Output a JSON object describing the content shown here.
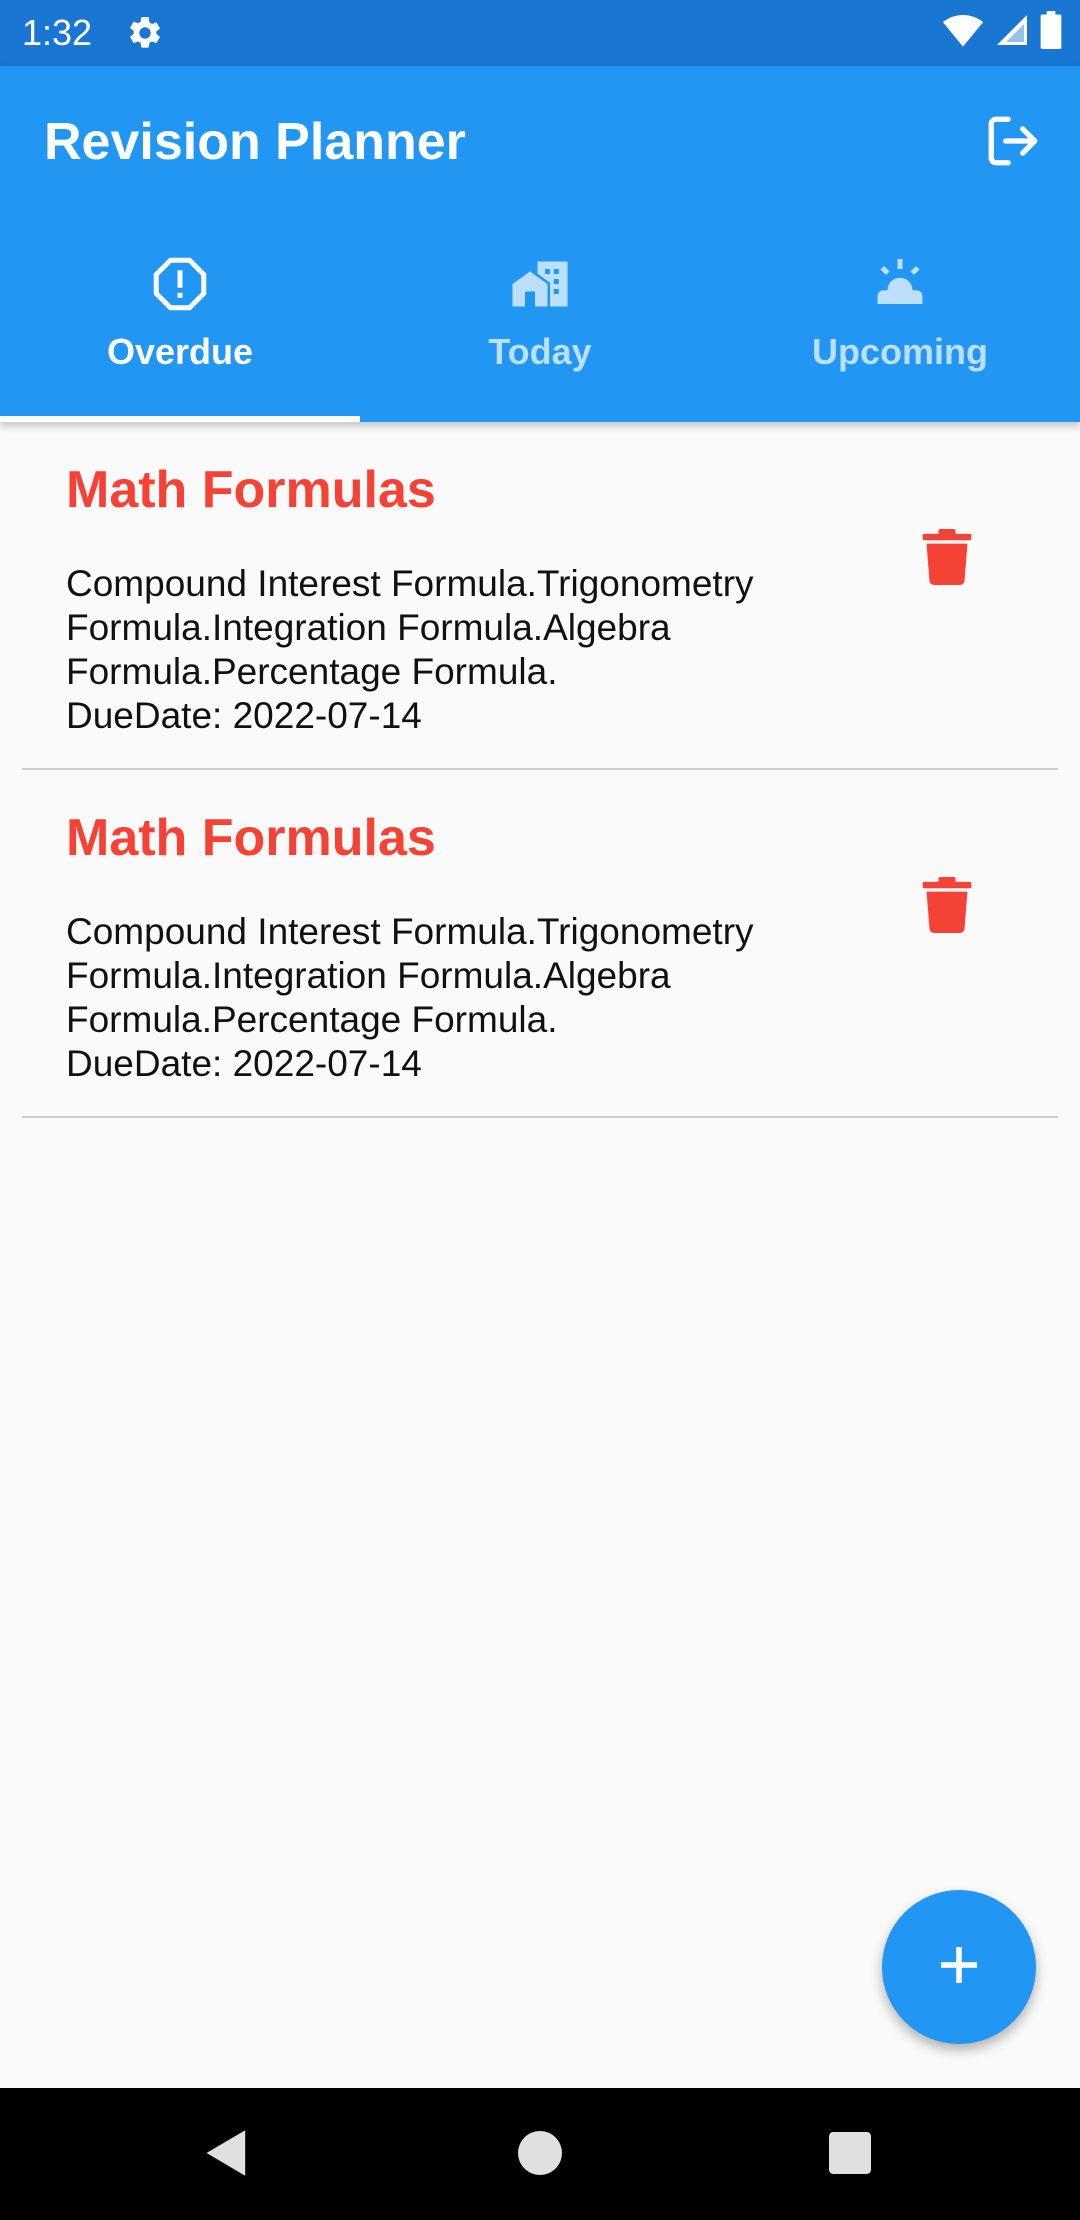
{
  "status_bar": {
    "time": "1:32",
    "icons": [
      "gear-icon",
      "wifi-icon",
      "signal-icon",
      "battery-icon"
    ]
  },
  "app_bar": {
    "title": "Revision Planner",
    "action_icon": "logout-icon"
  },
  "tabs": [
    {
      "label": "Overdue",
      "icon": "alert-octagon-icon",
      "active": true
    },
    {
      "label": "Today",
      "icon": "home-city-icon",
      "active": false
    },
    {
      "label": "Upcoming",
      "icon": "alarm-light-icon",
      "active": false
    }
  ],
  "items": [
    {
      "title": "Math Formulas",
      "description": "Compound Interest Formula.Trigonometry Formula.Integration Formula.Algebra Formula.Percentage Formula.",
      "due": "DueDate: 2022-07-14",
      "action_icon": "trash-icon"
    },
    {
      "title": "Math Formulas",
      "description": "Compound Interest Formula.Trigonometry Formula.Integration Formula.Algebra Formula.Percentage Formula.",
      "due": "DueDate: 2022-07-14",
      "action_icon": "trash-icon"
    }
  ],
  "fab": {
    "icon": "plus-icon"
  },
  "nav_bar": {
    "icons": [
      "back-icon",
      "home-icon",
      "recents-icon"
    ]
  },
  "colors": {
    "status_bar": "#1976d2",
    "primary": "#2196f3",
    "accent_red": "#f44336",
    "background": "#fafafa",
    "nav_bar": "#000000"
  }
}
